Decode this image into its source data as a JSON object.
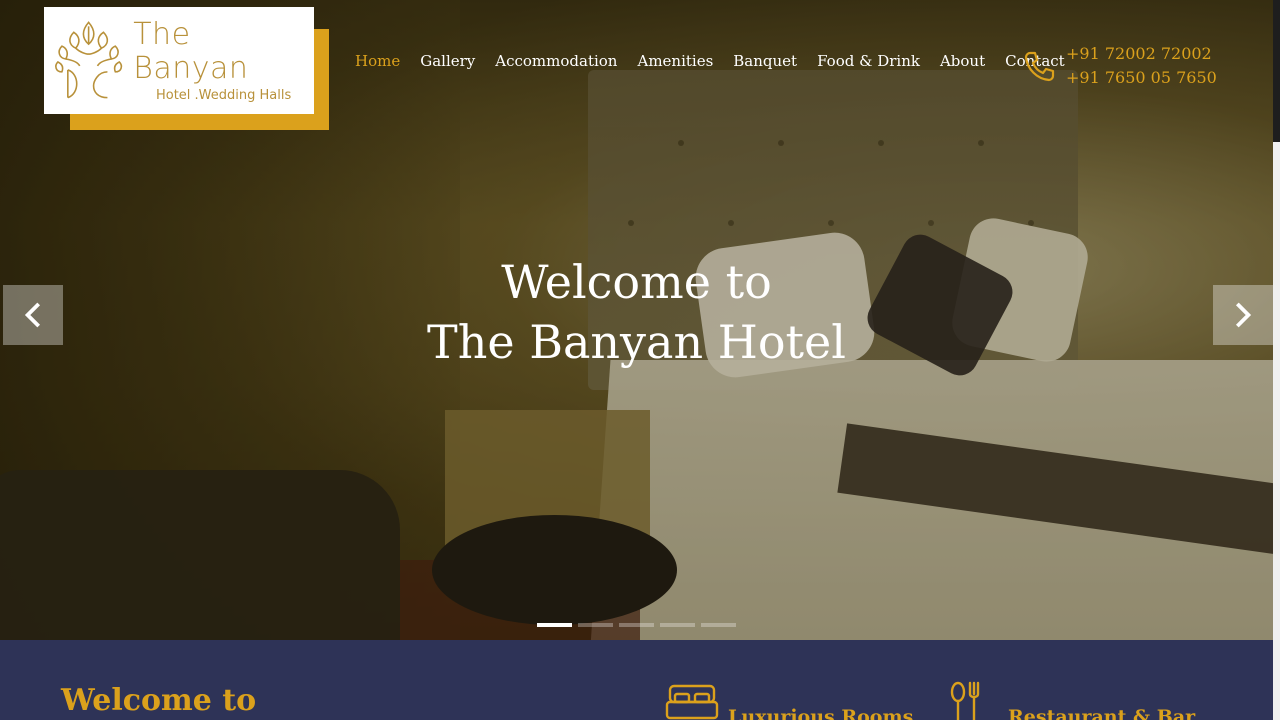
{
  "logo": {
    "brand": "The Banyan",
    "tagline": "Hotel .Wedding Halls"
  },
  "nav": {
    "items": [
      "Home",
      "Gallery",
      "Accommodation",
      "Amenities",
      "Banquet",
      "Food & Drink",
      "About",
      "Contact"
    ],
    "active": "Home"
  },
  "contact": {
    "phone_1": "+91 72002 72002",
    "phone_2": "+91 7650 05 7650",
    "icon": "phone-icon"
  },
  "hero": {
    "line_1": "Welcome to",
    "line_2": "The Banyan Hotel",
    "slide_count": 5,
    "active_slide": 1,
    "prev_icon": "chevron-left-icon",
    "next_icon": "chevron-right-icon"
  },
  "intro": {
    "heading": "Welcome to",
    "features": [
      {
        "label": "Luxurious Rooms",
        "icon": "bed-icon"
      },
      {
        "label": "Restaurant & Bar",
        "icon": "cutlery-icon"
      }
    ]
  },
  "colors": {
    "accent": "#dba11c",
    "section_bg": "#2e3357"
  }
}
